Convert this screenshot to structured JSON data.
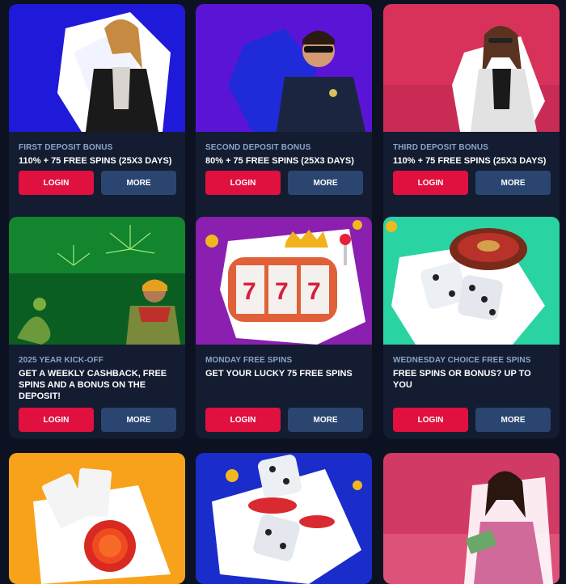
{
  "promos": [
    {
      "subtitle": "FIRST DEPOSIT BONUS",
      "title": "110% + 75 FREE SPINS (25X3 DAYS)",
      "login": "LOGIN",
      "more": "MORE",
      "bg": "#1f1ad9",
      "accent": "#ffffff",
      "icon": "woman-leather-jacket-illustration"
    },
    {
      "subtitle": "SECOND DEPOSIT BONUS",
      "title": "80% + 75 FREE SPINS (25X3 DAYS)",
      "login": "LOGIN",
      "more": "MORE",
      "bg": "#5a14d6",
      "accent": "#1f2ad8",
      "icon": "police-officer-illustration"
    },
    {
      "subtitle": "THIRD DEPOSIT BONUS",
      "title": "110% + 75 FREE SPINS (25X3 DAYS)",
      "login": "LOGIN",
      "more": "MORE",
      "bg": "#d8325a",
      "accent": "#ffffff",
      "icon": "woman-sunglasses-illustration"
    },
    {
      "subtitle": "2025 YEAR KICK-OFF",
      "title": "GET A WEEKLY CASHBACK, FREE SPINS AND A BONUS ON THE DEPOSIT!",
      "login": "LOGIN",
      "more": "MORE",
      "bg": "#12852e",
      "accent": "#0b5e22",
      "icon": "snake-fireworks-illustration"
    },
    {
      "subtitle": "MONDAY FREE SPINS",
      "title": "GET YOUR LUCKY 75 FREE SPINS",
      "login": "LOGIN",
      "more": "MORE",
      "bg": "#8a1fb0",
      "accent": "#ffffff",
      "icon": "slot-machine-777-illustration"
    },
    {
      "subtitle": "WEDNESDAY CHOICE FREE SPINS",
      "title": "FREE SPINS OR BONUS? UP TO YOU",
      "login": "LOGIN",
      "more": "MORE",
      "bg": "#2ad3a2",
      "accent": "#ffffff",
      "icon": "dice-roulette-illustration"
    },
    {
      "bg": "#f7a21a",
      "accent": "#ffffff",
      "icon": "cards-chip-illustration"
    },
    {
      "bg": "#1a2cc9",
      "accent": "#ffffff",
      "icon": "dice-chips-illustration"
    },
    {
      "bg": "#d23a66",
      "accent": "#e86a8a",
      "icon": "woman-cash-illustration"
    }
  ]
}
